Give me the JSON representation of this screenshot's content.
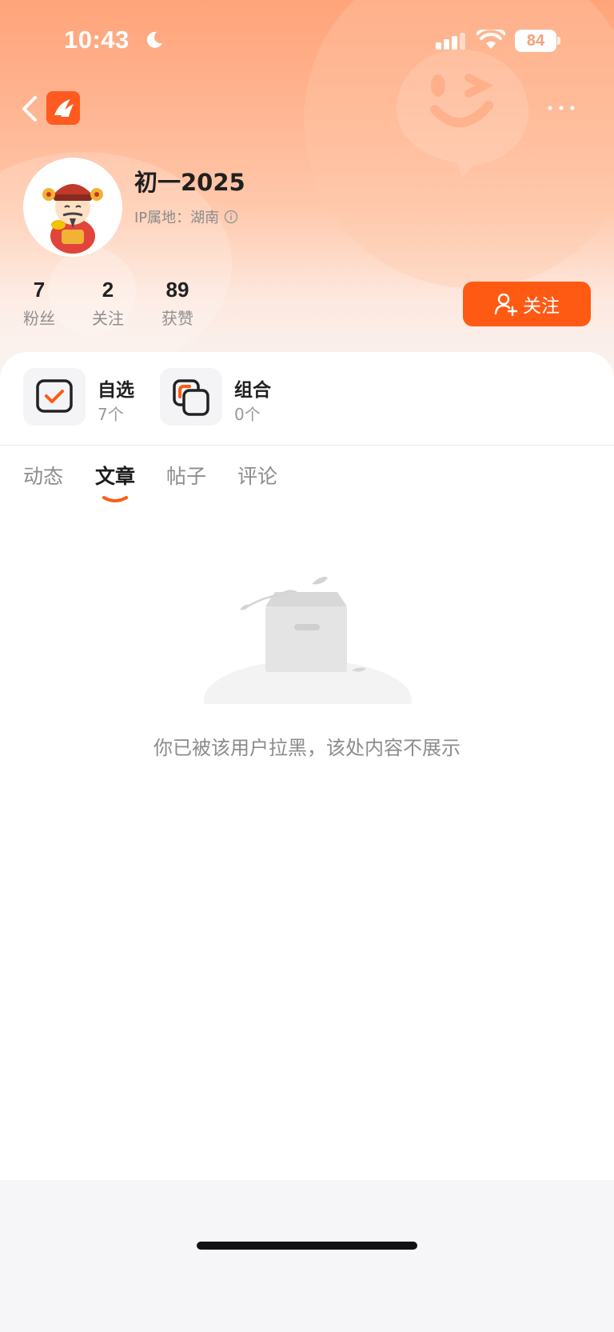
{
  "status_bar": {
    "time": "10:43",
    "battery": "84",
    "icons": [
      "moon-icon",
      "signal-icon",
      "wifi-icon",
      "battery-icon"
    ]
  },
  "nav": {
    "icons": [
      "back-icon",
      "app-logo",
      "more-icon"
    ]
  },
  "profile": {
    "username": "初一2025",
    "ip_location": "IP属地：湖南",
    "stats": [
      {
        "value": "7",
        "label": "粉丝"
      },
      {
        "value": "2",
        "label": "关注"
      },
      {
        "value": "89",
        "label": "获赞"
      }
    ],
    "follow_label": "关注"
  },
  "shortcuts": [
    {
      "title": "自选",
      "subtitle": "7个",
      "icon": "watchlist-icon"
    },
    {
      "title": "组合",
      "subtitle": "0个",
      "icon": "portfolio-icon"
    }
  ],
  "tabs": [
    {
      "label": "动态",
      "active": false
    },
    {
      "label": "文章",
      "active": true
    },
    {
      "label": "帖子",
      "active": false
    },
    {
      "label": "评论",
      "active": false
    }
  ],
  "empty_state": {
    "message": "你已被该用户拉黑，该处内容不展示"
  },
  "colors": {
    "accent": "#ff5a14",
    "header_top": "#ffa47a",
    "text_secondary": "#8c8c8c"
  }
}
